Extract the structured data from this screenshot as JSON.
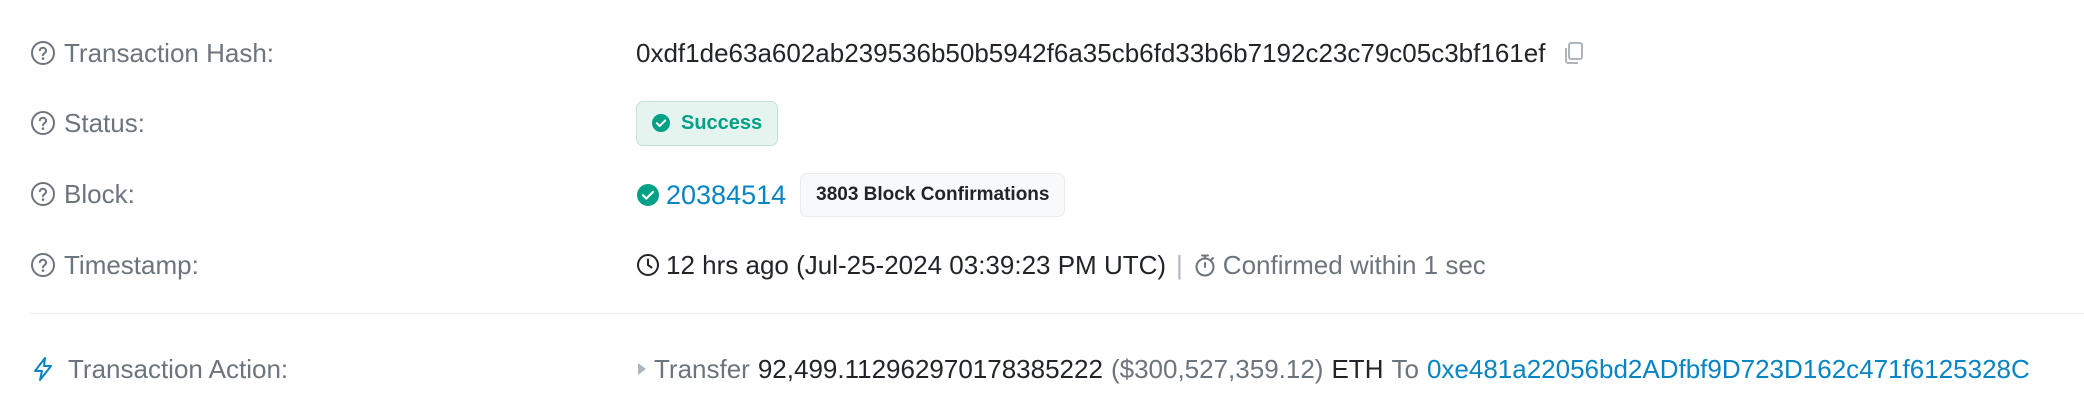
{
  "transaction_hash": {
    "label": "Transaction Hash:",
    "value": "0xdf1de63a602ab239536b50b5942f6a35cb6fd33b6b7192c23c79c05c3bf161ef",
    "icon": "help-circle-icon",
    "copy_icon": "copy-icon"
  },
  "status": {
    "label": "Status:",
    "value": "Success",
    "icon": "check-circle-icon",
    "color": "#00a186"
  },
  "block": {
    "label": "Block:",
    "number": "20384514",
    "confirmations": "3803 Block Confirmations",
    "link_color": "#0784c3"
  },
  "timestamp": {
    "label": "Timestamp:",
    "value": "12 hrs ago (Jul-25-2024 03:39:23 PM UTC)",
    "separator": "|",
    "confirmed": "Confirmed within 1 sec"
  },
  "transaction_action": {
    "label": "Transaction Action:",
    "verb": "Transfer",
    "amount": "92,499.112962970178385222",
    "usd": "($300,527,359.12)",
    "token": "ETH",
    "to_word": "To",
    "to_address": "0xe481a22056bd2ADfbf9D723D162c471f6125328C",
    "icon": "lightning-icon"
  }
}
